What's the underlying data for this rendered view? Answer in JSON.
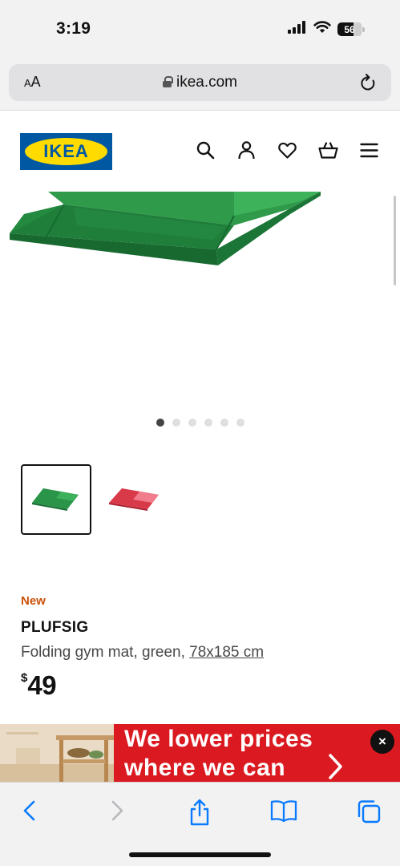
{
  "status": {
    "time": "3:19",
    "battery": "56"
  },
  "browser": {
    "text_size_label_small": "A",
    "text_size_label_large": "A",
    "url": "ikea.com"
  },
  "header": {
    "logo": "IKEA"
  },
  "gallery": {
    "slide_count": 6,
    "active_slide": 1
  },
  "product": {
    "badge": "New",
    "name": "PLUFSIG",
    "description": "Folding gym mat, green, ",
    "dimensions": "78x185 cm",
    "currency": "$",
    "price": "49"
  },
  "banner": {
    "line1": "We lower prices",
    "line2": "where we can",
    "close": "×"
  },
  "colors": {
    "ikea_blue": "#0058a3",
    "ikea_yellow": "#ffdb00",
    "new_orange": "#ca5008",
    "banner_red": "#da1a20",
    "safari_blue": "#0a7aff"
  }
}
